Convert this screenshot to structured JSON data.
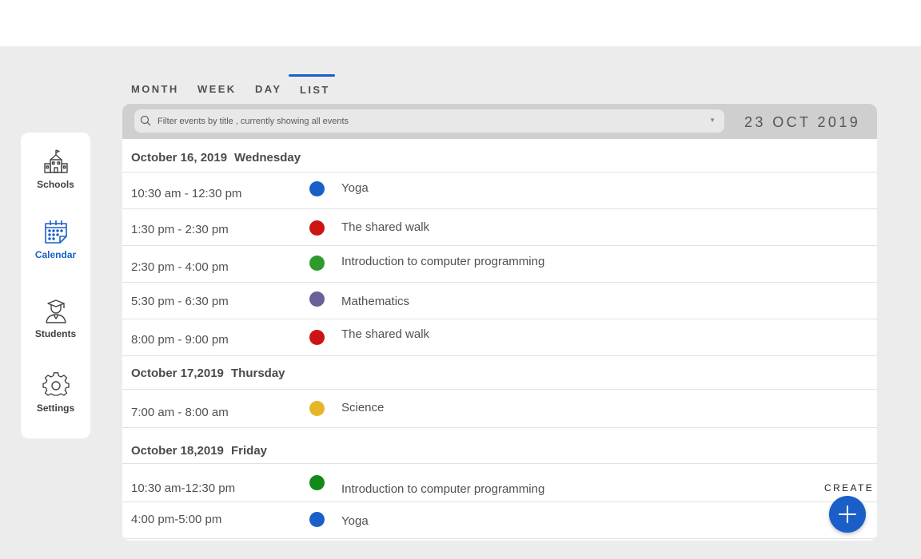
{
  "sidebar": {
    "items": [
      {
        "label": "Schools",
        "icon": "school-icon"
      },
      {
        "label": "Calendar",
        "icon": "calendar-icon",
        "active": true
      },
      {
        "label": "Students",
        "icon": "student-icon"
      },
      {
        "label": "Settings",
        "icon": "gear-icon"
      }
    ]
  },
  "tabs": {
    "month": "MONTH",
    "week": "WEEK",
    "day": "DAY",
    "list": "LIST",
    "active": "LIST"
  },
  "search": {
    "placeholder": "Filter events by title , currently showing all events"
  },
  "current_date": "23 OCT 2019",
  "colors": {
    "accent": "#1a5fc8",
    "blue": "#1a5fc8",
    "red": "#cc1414",
    "green": "#2e9a2e",
    "green_dark": "#118a18",
    "purple": "#6a5f96",
    "yellow": "#e6b62a"
  },
  "days": [
    {
      "date": "October 16, 2019",
      "weekday": "Wednesday",
      "events": [
        {
          "time": "10:30 am - 12:30 pm",
          "title": "Yoga",
          "color": "#1a5fc8"
        },
        {
          "time": "1:30 pm - 2:30 pm",
          "title": "The shared walk",
          "color": "#cc1414"
        },
        {
          "time": "2:30 pm - 4:00 pm",
          "title": "Introduction to computer programming",
          "color": "#2e9a2e"
        },
        {
          "time": "5:30 pm - 6:30 pm",
          "title": "Mathematics",
          "color": "#6a5f96"
        },
        {
          "time": "8:00 pm - 9:00 pm",
          "title": "The shared walk",
          "color": "#cc1414"
        }
      ]
    },
    {
      "date": "October 17,2019",
      "weekday": "Thursday",
      "events": [
        {
          "time": "7:00 am - 8:00 am",
          "title": "Science",
          "color": "#e6b62a"
        }
      ]
    },
    {
      "date": "October 18,2019",
      "weekday": "Friday",
      "events": [
        {
          "time": "10:30 am-12:30 pm",
          "title": "Introduction to computer programming",
          "color": "#118a18"
        },
        {
          "time": "4:00 pm-5:00 pm",
          "title": "Yoga",
          "color": "#1a5fc8"
        }
      ]
    }
  ],
  "create": {
    "label": "CREATE",
    "icon": "plus-icon"
  }
}
